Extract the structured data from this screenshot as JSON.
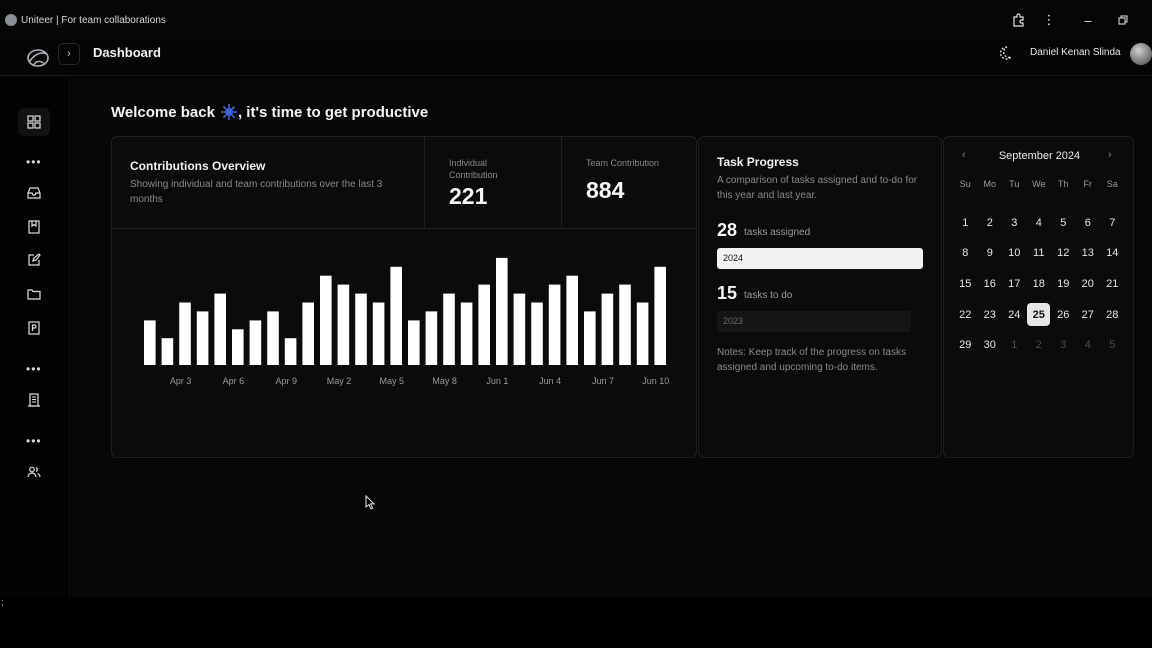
{
  "window": {
    "title": "Uniteer | For team collaborations"
  },
  "header": {
    "page_title": "Dashboard",
    "user_name": "Daniel Kenan Slinda"
  },
  "sidebar": {
    "items": [
      {
        "icon": "grid-icon"
      },
      {
        "icon": "inbox-icon"
      },
      {
        "icon": "bookmark-square-icon"
      },
      {
        "icon": "edit-icon"
      },
      {
        "icon": "folder-icon"
      },
      {
        "icon": "document-p-icon"
      },
      {
        "icon": "building-icon"
      },
      {
        "icon": "users-icon"
      }
    ]
  },
  "welcome": {
    "before": "Welcome back",
    "after": ", it's time to get productive"
  },
  "contributions": {
    "title": "Contributions Overview",
    "subtitle": "Showing individual and team contributions over the last 3 months",
    "individual_label": "Individual Contribution",
    "individual_value": "221",
    "team_label": "Team Contribution",
    "team_value": "884"
  },
  "chart_data": {
    "type": "bar",
    "title": "",
    "xlabel": "",
    "ylabel": "",
    "ylim": [
      0,
      14
    ],
    "grid": false,
    "tick_labels": [
      "Apr 3",
      "Apr 6",
      "Apr 9",
      "May 2",
      "May 5",
      "May 8",
      "Jun 1",
      "Jun 4",
      "Jun 7",
      "Jun 10"
    ],
    "values": [
      5,
      3,
      7,
      6,
      8,
      4,
      5,
      6,
      3,
      7,
      10,
      9,
      8,
      7,
      11,
      5,
      6,
      8,
      7,
      9,
      12,
      8,
      7,
      9,
      10,
      6,
      8,
      9,
      7,
      11
    ]
  },
  "task_progress": {
    "title": "Task Progress",
    "subtitle": "A comparison of tasks assigned and to-do for this year and last year.",
    "assigned_count": "28",
    "assigned_label": "tasks assigned",
    "assigned_year": "2024",
    "todo_count": "15",
    "todo_label": "tasks to do",
    "todo_year": "2023",
    "notes": "Notes: Keep track of the progress on tasks assigned and upcoming to-do items."
  },
  "calendar": {
    "month": "September 2024",
    "weekdays": [
      "Su",
      "Mo",
      "Tu",
      "We",
      "Th",
      "Fr",
      "Sa"
    ],
    "selected": "25",
    "days": [
      "1",
      "2",
      "3",
      "4",
      "5",
      "6",
      "7",
      "8",
      "9",
      "10",
      "11",
      "12",
      "13",
      "14",
      "15",
      "16",
      "17",
      "18",
      "19",
      "20",
      "21",
      "22",
      "23",
      "24",
      "25",
      "26",
      "27",
      "28",
      "29",
      "30",
      "1",
      "2",
      "3",
      "4",
      "5"
    ],
    "trailing_out_count": 5
  },
  "colors": {
    "accent": "#ffffff",
    "background": "#070707",
    "card": "#0b0b0b",
    "muted": "#8a8a8a",
    "emoji": "#3f63d9"
  }
}
